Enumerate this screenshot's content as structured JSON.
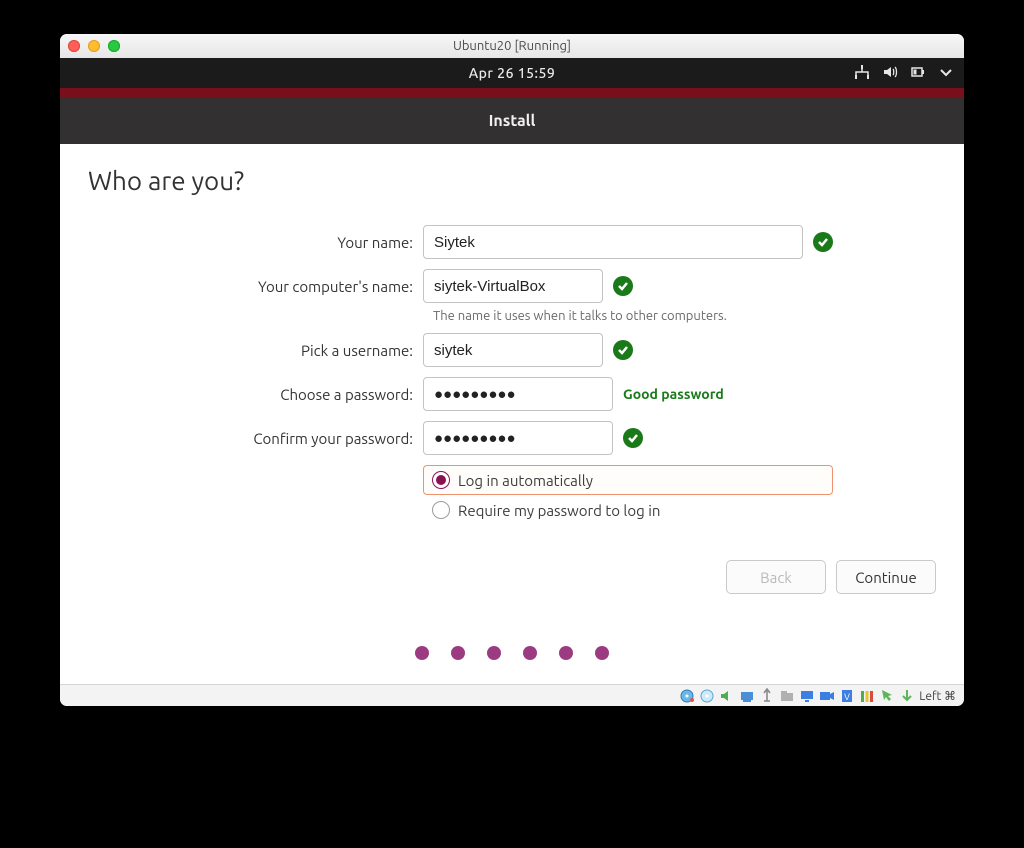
{
  "host_window": {
    "title": "Ubuntu20 [Running]"
  },
  "gnome_top": {
    "datetime": "Apr 26  15:59"
  },
  "installer": {
    "title": "Install",
    "heading": "Who are you?",
    "labels": {
      "name": "Your name:",
      "computer": "Your computer's name:",
      "computer_hint": "The name it uses when it talks to other computers.",
      "username": "Pick a username:",
      "password": "Choose a password:",
      "confirm": "Confirm your password:"
    },
    "values": {
      "name": "Siytek",
      "computer": "siytek-VirtualBox",
      "username": "siytek",
      "password": "●●●●●●●●●",
      "confirm": "●●●●●●●●●"
    },
    "password_strength": "Good password",
    "radios": {
      "auto": "Log in automatically",
      "require": "Require my password to log in",
      "selected": "auto"
    },
    "buttons": {
      "back": "Back",
      "continue": "Continue"
    }
  },
  "vb_status": {
    "hostkey": "Left ⌘"
  }
}
